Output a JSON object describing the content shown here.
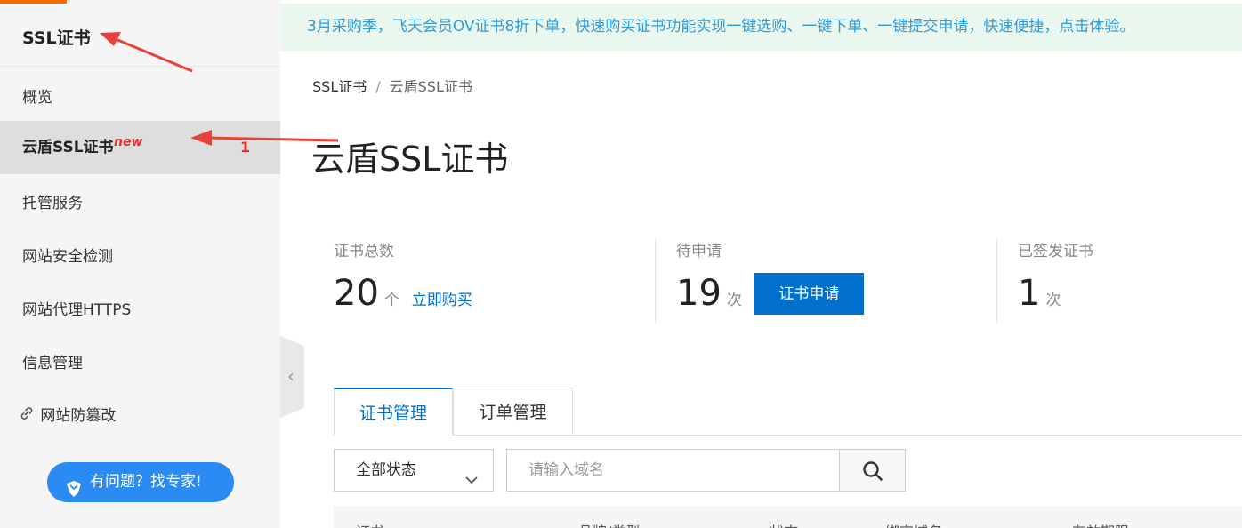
{
  "sidebar": {
    "title": "SSL证书",
    "items": [
      {
        "label": "概览"
      },
      {
        "label": "云盾SSL证书",
        "badge": "new",
        "count": "1"
      },
      {
        "label": "托管服务"
      },
      {
        "label": "网站安全检测"
      },
      {
        "label": "网站代理HTTPS"
      },
      {
        "label": "信息管理"
      },
      {
        "label": "网站防篡改"
      }
    ],
    "help_button": "有问题？找专家!"
  },
  "notice": "3月采购季，飞天会员OV证书8折下单，快速购买证书功能实现一键选购、一键下单、一键提交申请，快速便捷，点击体验。",
  "breadcrumb": {
    "root": "SSL证书",
    "separator": "/",
    "current": "云盾SSL证书"
  },
  "page_title": "云盾SSL证书",
  "stats": [
    {
      "label": "证书总数",
      "value": "20",
      "unit": "个",
      "action": "立即购买"
    },
    {
      "label": "待申请",
      "value": "19",
      "unit": "次",
      "action": "证书申请"
    },
    {
      "label": "已签发证书",
      "value": "1",
      "unit": "次"
    }
  ],
  "tabs": [
    "证书管理",
    "订单管理"
  ],
  "filter": {
    "selected": "全部状态"
  },
  "search": {
    "placeholder": "请输入域名"
  },
  "table_headers": [
    "证书",
    "品牌/类型",
    "状态",
    "绑定域名",
    "有效期限"
  ],
  "colors": {
    "accent": "#0070cc",
    "orange": "#ff6a00",
    "annotation": "#e8413a"
  }
}
